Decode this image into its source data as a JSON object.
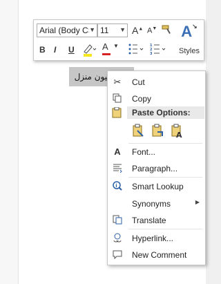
{
  "toolbar": {
    "font_name": "Arial (Body CS",
    "font_size": "11",
    "grow_font": "A",
    "shrink_font": "A",
    "bold": "B",
    "italic": "I",
    "underline": "U",
    "font_color": "A",
    "styles_label": "Styles"
  },
  "document": {
    "selected_text": "کرایه بیون منزل"
  },
  "menu": {
    "cut": "Cut",
    "copy": "Copy",
    "paste_options": "Paste Options:",
    "font": "Font...",
    "paragraph": "Paragraph...",
    "smart_lookup": "Smart Lookup",
    "synonyms": "Synonyms",
    "translate": "Translate",
    "hyperlink": "Hyperlink...",
    "new_comment": "New Comment"
  },
  "colors": {
    "highlight_border": "#e0212b",
    "styles_accent": "#3a6fb7",
    "font_color_red": "#d62222",
    "highlighter_yellow": "#f5e61d"
  }
}
